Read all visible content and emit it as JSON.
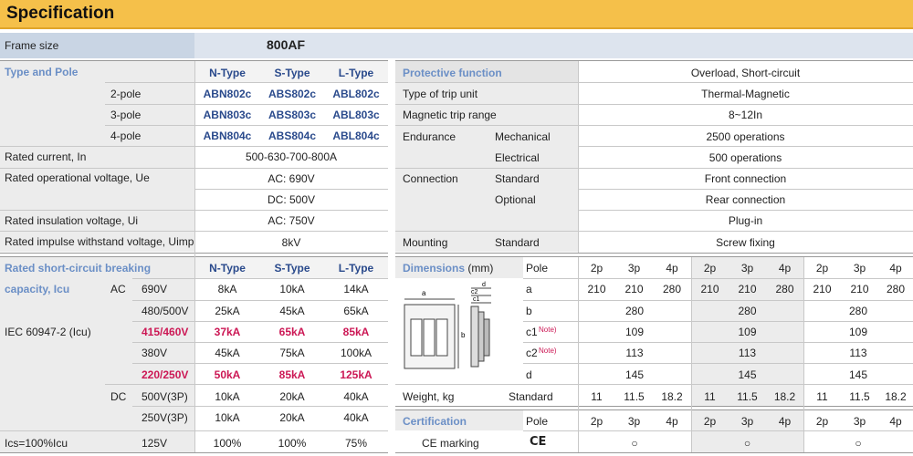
{
  "title": "Specification",
  "frame": {
    "label": "Frame size",
    "value": "800AF"
  },
  "type_pole": {
    "label": "Type and Pole",
    "headers": [
      "N-Type",
      "S-Type",
      "L-Type"
    ],
    "rows": [
      {
        "pole": "2-pole",
        "n": "ABN802c",
        "s": "ABS802c",
        "l": "ABL802c"
      },
      {
        "pole": "3-pole",
        "n": "ABN803c",
        "s": "ABS803c",
        "l": "ABL803c"
      },
      {
        "pole": "4-pole",
        "n": "ABN804c",
        "s": "ABS804c",
        "l": "ABL804c"
      }
    ]
  },
  "rated": {
    "current_label": "Rated current, In",
    "current_value": "500-630-700-800A",
    "op_voltage_label": "Rated operational voltage, Ue",
    "op_voltage_ac": "AC: 690V",
    "op_voltage_dc": "DC: 500V",
    "insulation_label": "Rated insulation voltage, Ui",
    "insulation_value": "AC: 750V",
    "impulse_label": "Rated impulse withstand voltage, Uimp",
    "impulse_value": "8kV"
  },
  "breaking": {
    "label1": "Rated short-circuit breaking",
    "label2": "capacity, Icu",
    "headers": [
      "N-Type",
      "S-Type",
      "L-Type"
    ],
    "ac": "AC",
    "dc": "DC",
    "standard": "IEC 60947-2 (Icu)",
    "rows": [
      {
        "v": "690V",
        "n": "8kA",
        "s": "10kA",
        "l": "14kA"
      },
      {
        "v": "480/500V",
        "n": "25kA",
        "s": "45kA",
        "l": "65kA"
      },
      {
        "v": "415/460V",
        "n": "37kA",
        "s": "65kA",
        "l": "85kA"
      },
      {
        "v": "380V",
        "n": "45kA",
        "s": "75kA",
        "l": "100kA"
      },
      {
        "v": "220/250V",
        "n": "50kA",
        "s": "85kA",
        "l": "125kA"
      },
      {
        "v": "500V(3P)",
        "n": "10kA",
        "s": "20kA",
        "l": "40kA"
      },
      {
        "v": "250V(3P)",
        "n": "10kA",
        "s": "20kA",
        "l": "40kA"
      }
    ],
    "ics_label": "Ics=100%Icu",
    "ics_v": "125V",
    "ics_n": "100%",
    "ics_s": "100%",
    "ics_l": "75%"
  },
  "right": {
    "protective_label": "Protective function",
    "protective_value": "Overload, Short-circuit",
    "trip_unit_label": "Type of trip unit",
    "trip_unit_value": "Thermal-Magnetic",
    "trip_range_label": "Magnetic trip range",
    "trip_range_value": "8~12In",
    "endurance_label": "Endurance",
    "mechanical_label": "Mechanical",
    "mechanical_value": "2500 operations",
    "electrical_label": "Electrical",
    "electrical_value": "500 operations",
    "connection_label": "Connection",
    "standard_label": "Standard",
    "standard_value": "Front connection",
    "optional_label": "Optional",
    "optional_value1": "Rear connection",
    "optional_value2": "Plug-in",
    "mounting_label": "Mounting",
    "mounting_std": "Standard",
    "mounting_value": "Screw fixing"
  },
  "dimensions": {
    "label": "Dimensions",
    "unit": "(mm)",
    "pole_label": "Pole",
    "poles": [
      "2p",
      "3p",
      "4p",
      "2p",
      "3p",
      "4p",
      "2p",
      "3p",
      "4p"
    ],
    "a_label": "a",
    "a_values": [
      "210",
      "210",
      "280",
      "210",
      "210",
      "280",
      "210",
      "210",
      "280"
    ],
    "b_label": "b",
    "b_values": [
      "280",
      "280",
      "280"
    ],
    "c1_label": "c1",
    "c1_values": [
      "109",
      "109",
      "109"
    ],
    "c2_label": "c2",
    "c2_values": [
      "113",
      "113",
      "113"
    ],
    "d_label": "d",
    "d_values": [
      "145",
      "145",
      "145"
    ],
    "note": "Note)",
    "diagram_labels": {
      "a": "a",
      "b": "b",
      "c1": "c1",
      "c2": "c2",
      "d": "d"
    }
  },
  "weight": {
    "label": "Weight, kg",
    "standard": "Standard",
    "values": [
      "11",
      "11.5",
      "18.2",
      "11",
      "11.5",
      "18.2",
      "11",
      "11.5",
      "18.2"
    ]
  },
  "certification": {
    "label": "Certification",
    "pole_label": "Pole",
    "poles": [
      "2p",
      "3p",
      "4p",
      "2p",
      "3p",
      "4p",
      "2p",
      "3p",
      "4p"
    ],
    "ce_label": "CE marking",
    "ce_symbol": "CE",
    "mark": "○"
  }
}
